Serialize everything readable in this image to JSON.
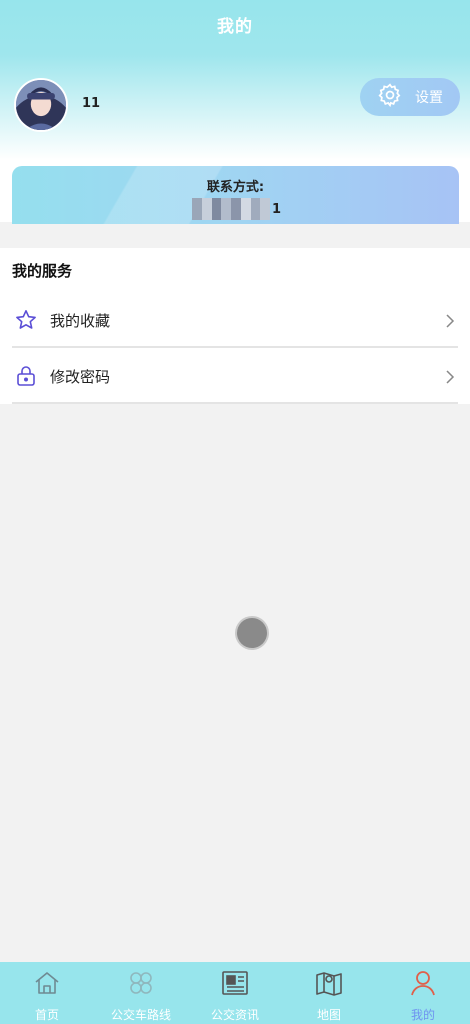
{
  "header": {
    "title": "我的"
  },
  "profile": {
    "username": "11",
    "avatar_icon": "avatar-photo"
  },
  "settings": {
    "label": "设置",
    "icon": "gear-icon"
  },
  "contact": {
    "label": "联系方式:",
    "value_suffix": "1"
  },
  "services": {
    "title": "我的服务",
    "items": [
      {
        "label": "我的收藏",
        "icon": "star-icon"
      },
      {
        "label": "修改密码",
        "icon": "lock-icon"
      }
    ]
  },
  "tabbar": {
    "active_index": 4,
    "active_color": "#6f93f0",
    "items": [
      {
        "label": "首页",
        "icon": "home-icon"
      },
      {
        "label": "公交车路线",
        "icon": "route-icon"
      },
      {
        "label": "公交资讯",
        "icon": "news-icon"
      },
      {
        "label": "地图",
        "icon": "map-icon"
      },
      {
        "label": "我的",
        "icon": "user-icon"
      }
    ]
  },
  "colors": {
    "theme": "#97e5ec",
    "icon_purple": "#5b4fd6"
  }
}
